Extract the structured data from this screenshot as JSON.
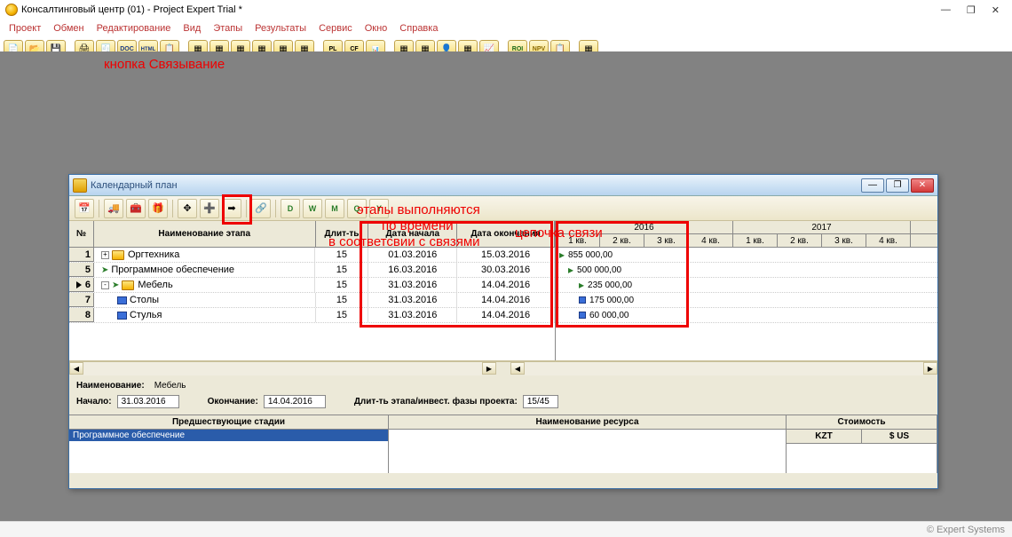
{
  "app": {
    "title": "Консалтинговый центр (01) - Project Expert Trial *",
    "status_right": "© Expert Systems"
  },
  "menu": [
    "Проект",
    "Обмен",
    "Редактирование",
    "Вид",
    "Этапы",
    "Результаты",
    "Сервис",
    "Окно",
    "Справка"
  ],
  "child": {
    "title": "Календарный план",
    "toolbar_letters": [
      "D",
      "W",
      "M",
      "Q",
      "Y"
    ]
  },
  "grid": {
    "headers": {
      "num": "№",
      "name": "Наименование этапа",
      "dur": "Длит-ть",
      "start": "Дата начала",
      "end": "Дата окончания"
    },
    "gantt_years": [
      "2016",
      "2017"
    ],
    "gantt_q": [
      "1 кв.",
      "2 кв.",
      "3 кв.",
      "4 кв.",
      "1 кв.",
      "2 кв.",
      "3 кв.",
      "4 кв."
    ],
    "rows": [
      {
        "n": "1",
        "name": "Оргтехника",
        "dur": "15",
        "start": "01.03.2016",
        "end": "15.03.2016",
        "indent": 1,
        "exp": "+",
        "val": "855 000,00",
        "gx": 4,
        "gtype": "open"
      },
      {
        "n": "5",
        "name": "Программное обеспечение",
        "dur": "15",
        "start": "16.03.2016",
        "end": "30.03.2016",
        "indent": 1,
        "exp": "",
        "val": "500 000,00",
        "gx": 14,
        "gtype": "open",
        "arrow": true
      },
      {
        "n": "6",
        "name": "Мебель",
        "dur": "15",
        "start": "31.03.2016",
        "end": "14.04.2016",
        "indent": 1,
        "exp": "-",
        "val": "235 000,00",
        "gx": 26,
        "gtype": "open",
        "sel": true,
        "arrow": true
      },
      {
        "n": "7",
        "name": "Столы",
        "dur": "15",
        "start": "31.03.2016",
        "end": "14.04.2016",
        "indent": 2,
        "exp": "",
        "val": "175 000,00",
        "gx": 26,
        "gtype": "box",
        "blue": true
      },
      {
        "n": "8",
        "name": "Стулья",
        "dur": "15",
        "start": "31.03.2016",
        "end": "14.04.2016",
        "indent": 2,
        "exp": "",
        "val": "60 000,00",
        "gx": 26,
        "gtype": "box",
        "blue": true
      }
    ]
  },
  "detail": {
    "name_lbl": "Наименование:",
    "name": "Мебель",
    "start_lbl": "Начало:",
    "start": "31.03.2016",
    "end_lbl": "Окончание:",
    "end": "14.04.2016",
    "dur_lbl": "Длит-ть этапа/инвест. фазы проекта:",
    "dur": "15/45",
    "pred_hdr": "Предшествующие стадии",
    "pred_row": "Программное обеспечение",
    "res_hdr": "Наименование ресурса",
    "cost_hdr": "Стоимость",
    "cost_c1": "KZT",
    "cost_c2": "$ US"
  },
  "annotations": {
    "a1": "кнопка Связывание",
    "a2": "этапы выполняются",
    "a3": "по времени",
    "a4": "в соответсвии с связями",
    "a5": "цепочка связи"
  }
}
